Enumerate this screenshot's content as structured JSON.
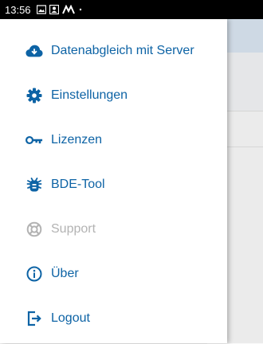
{
  "status_bar": {
    "time": "13:56",
    "icons": [
      "image-icon",
      "portrait-icon",
      "app-icon",
      "dot-icon"
    ]
  },
  "colors": {
    "accent": "#0d63a5",
    "disabled": "#b3b3b3",
    "drawer_bg": "#ffffff",
    "status_bar": "#000000"
  },
  "drawer": {
    "items": [
      {
        "label": "Datenabgleich mit Server",
        "icon": "cloud-download-icon",
        "enabled": true
      },
      {
        "label": "Einstellungen",
        "icon": "gear-icon",
        "enabled": true
      },
      {
        "label": "Lizenzen",
        "icon": "key-icon",
        "enabled": true
      },
      {
        "label": "BDE-Tool",
        "icon": "bug-icon",
        "enabled": true
      },
      {
        "label": "Support",
        "icon": "lifebuoy-icon",
        "enabled": false
      },
      {
        "label": "Über",
        "icon": "info-icon",
        "enabled": true
      },
      {
        "label": "Logout",
        "icon": "logout-icon",
        "enabled": true
      }
    ]
  }
}
